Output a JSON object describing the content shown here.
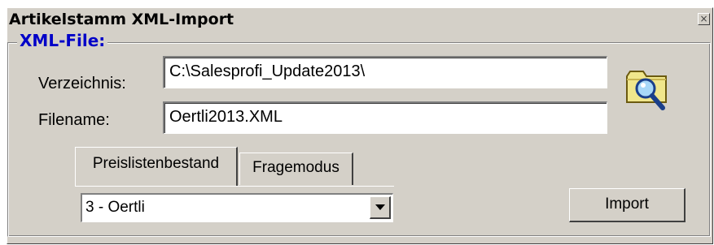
{
  "window": {
    "title": "Artikelstamm XML-Import",
    "close_glyph": "×"
  },
  "group": {
    "label": "XML-File:"
  },
  "fields": {
    "directory_label": "Verzeichnis:",
    "directory_value": "C:\\Salesprofi_Update2013\\",
    "filename_label": "Filename:",
    "filename_value": "Oertli2013.XML"
  },
  "tabs": [
    {
      "label": "Preislistenbestand",
      "active": true
    },
    {
      "label": "Fragemodus",
      "active": false
    }
  ],
  "pricelist_select": {
    "selected": "3 - Oertli"
  },
  "import_button": {
    "label": "Import"
  },
  "icons": {
    "browse": "folder-search-icon",
    "dropdown": "chevron-down-icon",
    "close": "close-icon"
  },
  "colors": {
    "window_bg": "#d4d0c8",
    "group_label": "#0000c8",
    "folder": "#f0e68c",
    "magnifier_lens": "#a8d8f8"
  }
}
